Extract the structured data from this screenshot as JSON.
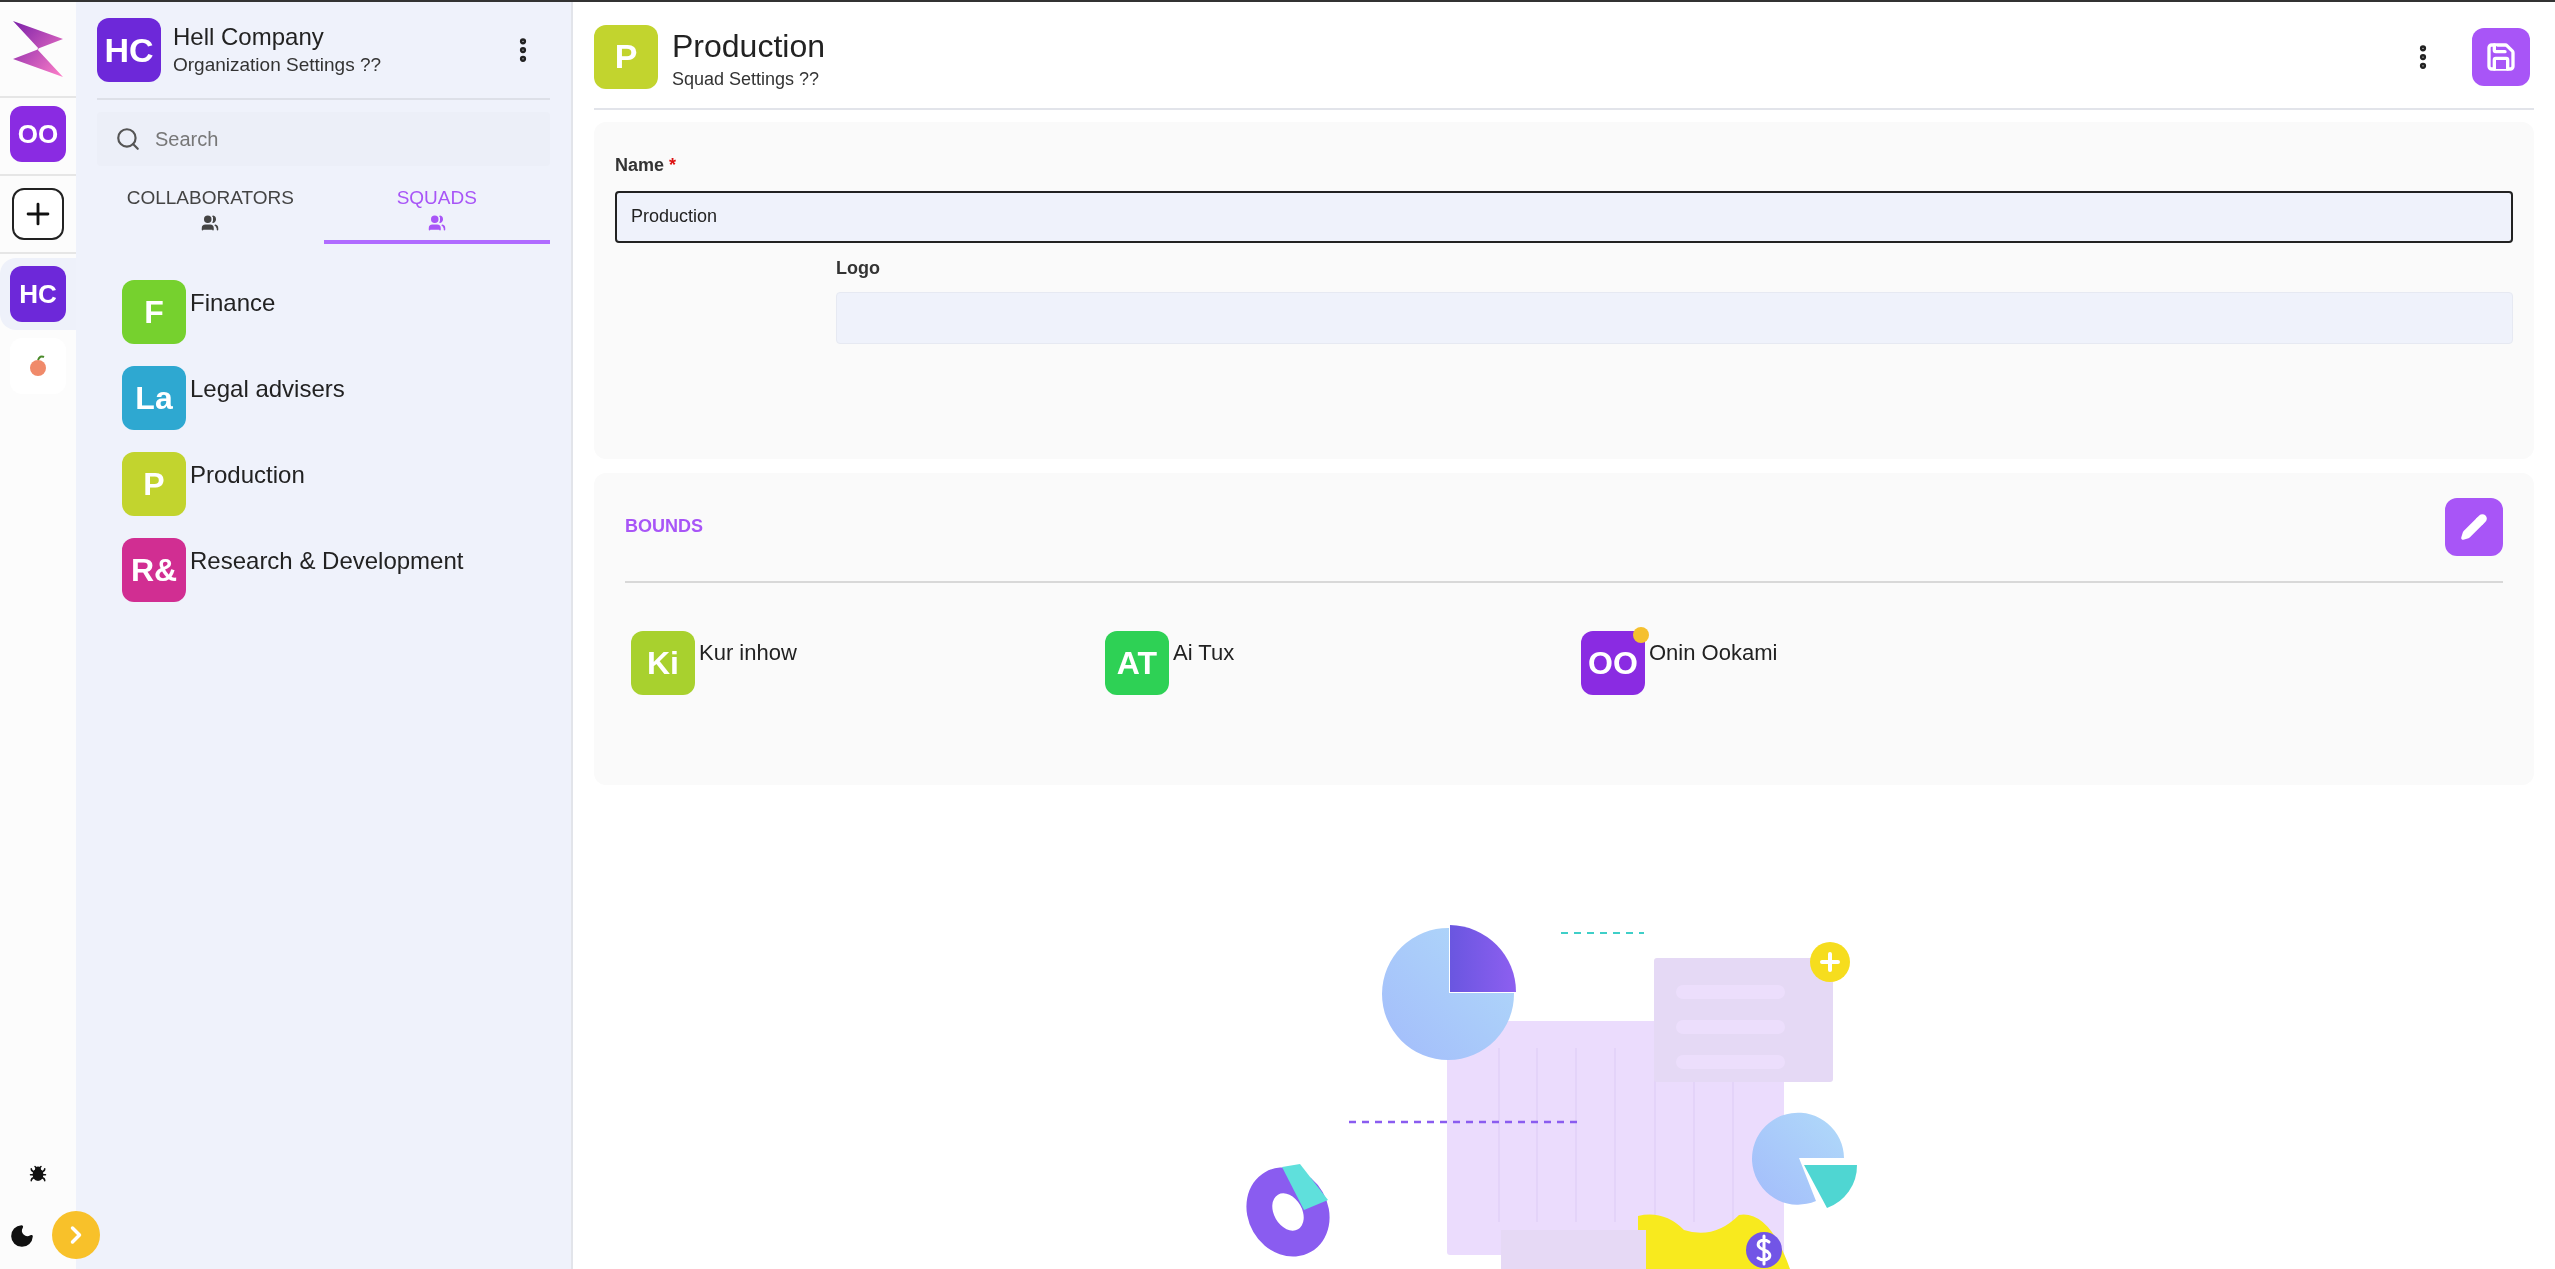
{
  "rail": {
    "items": [
      {
        "kind": "avatar",
        "initials": "OO",
        "color": "#8a2be2",
        "selected": false
      },
      {
        "kind": "add",
        "selected": false
      },
      {
        "kind": "avatar",
        "initials": "HC",
        "color": "#6d28d9",
        "selected": true
      },
      {
        "kind": "logo",
        "selected": false
      }
    ]
  },
  "sidebar": {
    "org": {
      "initials": "HC",
      "color": "#6d28d9",
      "title": "Hell Company",
      "subtitle": "Organization Settings ??"
    },
    "search": {
      "placeholder": "Search"
    },
    "tabs": [
      {
        "label": "COLLABORATORS",
        "selected": false
      },
      {
        "label": "SQUADS",
        "selected": true
      }
    ],
    "items": [
      {
        "initials": "F",
        "name": "Finance",
        "color": "#76d12e"
      },
      {
        "initials": "La",
        "name": "Legal advisers",
        "color": "#2ea8d1"
      },
      {
        "initials": "P",
        "name": "Production",
        "color": "#c2d42e"
      },
      {
        "initials": "R&",
        "name": "Research & Development",
        "color": "#d12e92"
      }
    ]
  },
  "header": {
    "initials": "P",
    "color": "#c2d42e",
    "title": "Production",
    "subtitle": "Squad Settings ??"
  },
  "form": {
    "name_label": "Name",
    "required_mark": "*",
    "name_value": "Production",
    "logo_label": "Logo"
  },
  "bounds": {
    "title": "BOUNDS",
    "members": [
      {
        "initials": "Ki",
        "name": "Kur inhow",
        "color": "#a8d12e",
        "notification": false
      },
      {
        "initials": "AT",
        "name": "Ai Tux",
        "color": "#2ed155",
        "notification": false
      },
      {
        "initials": "OO",
        "name": "Onin Ookami",
        "color": "#8a2be2",
        "notification": true
      }
    ]
  }
}
